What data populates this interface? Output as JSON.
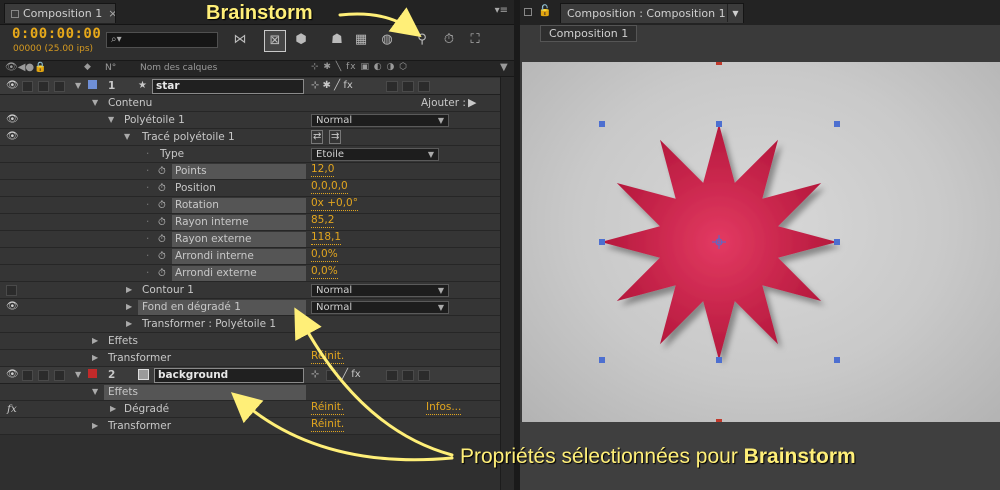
{
  "timeline": {
    "tab_label": "Composition 1",
    "tab_close": "×",
    "panel_menu": "▾≡",
    "timecode": "0:00:00:00",
    "frames_fps": "00000 (25.00 ips)",
    "search_placeholder": "",
    "columns": {
      "num": "N°",
      "layer_names": "Nom des calques",
      "switches": "⊹ ✱ ╲ fx ▣ ◐ ◑ ⬡"
    }
  },
  "layers": [
    {
      "id": 1,
      "num": "1",
      "name": "star",
      "color": "#6f8fd6"
    },
    {
      "id": 2,
      "num": "2",
      "name": "background",
      "color": "#c22a2a"
    }
  ],
  "properties": {
    "contenu": "Contenu",
    "ajouter": "Ajouter :",
    "polystar": "Polyétoile 1",
    "polystar_mode": "Normal",
    "trace": "Tracé polyétoile 1",
    "type_label": "Type",
    "type_value": "Etoile",
    "points_label": "Points",
    "points_value": "12,0",
    "position_label": "Position",
    "position_value": "0,0,0,0",
    "rotation_label": "Rotation",
    "rotation_value": "0x +0,0°",
    "rayon_interne_label": "Rayon interne",
    "rayon_interne_value": "85,2",
    "rayon_externe_label": "Rayon externe",
    "rayon_externe_value": "118,1",
    "arrondi_interne_label": "Arrondi interne",
    "arrondi_interne_value": "0,0%",
    "arrondi_externe_label": "Arrondi externe",
    "arrondi_externe_value": "0,0%",
    "contour": "Contour 1",
    "contour_mode": "Normal",
    "fond": "Fond en dégradé 1",
    "fond_mode": "Normal",
    "transformer_poly": "Transformer : Polyétoile 1",
    "effets": "Effets",
    "transformer": "Transformer",
    "reinit": "Réinit.",
    "effets2": "Effets",
    "degrade": "Dégradé",
    "reinit2": "Réinit.",
    "infos": "Infos...",
    "transformer2": "Transformer",
    "reinit3": "Réinit."
  },
  "comp_viewer": {
    "tab_label": "Composition : Composition 1",
    "breadcrumb": "Composition 1",
    "star_color": "#c8173f"
  },
  "annotations": {
    "top": "Brainstorm",
    "bottom_prefix": "Propriétés sélectionnées pour ",
    "bottom_bold": "Brainstorm"
  }
}
